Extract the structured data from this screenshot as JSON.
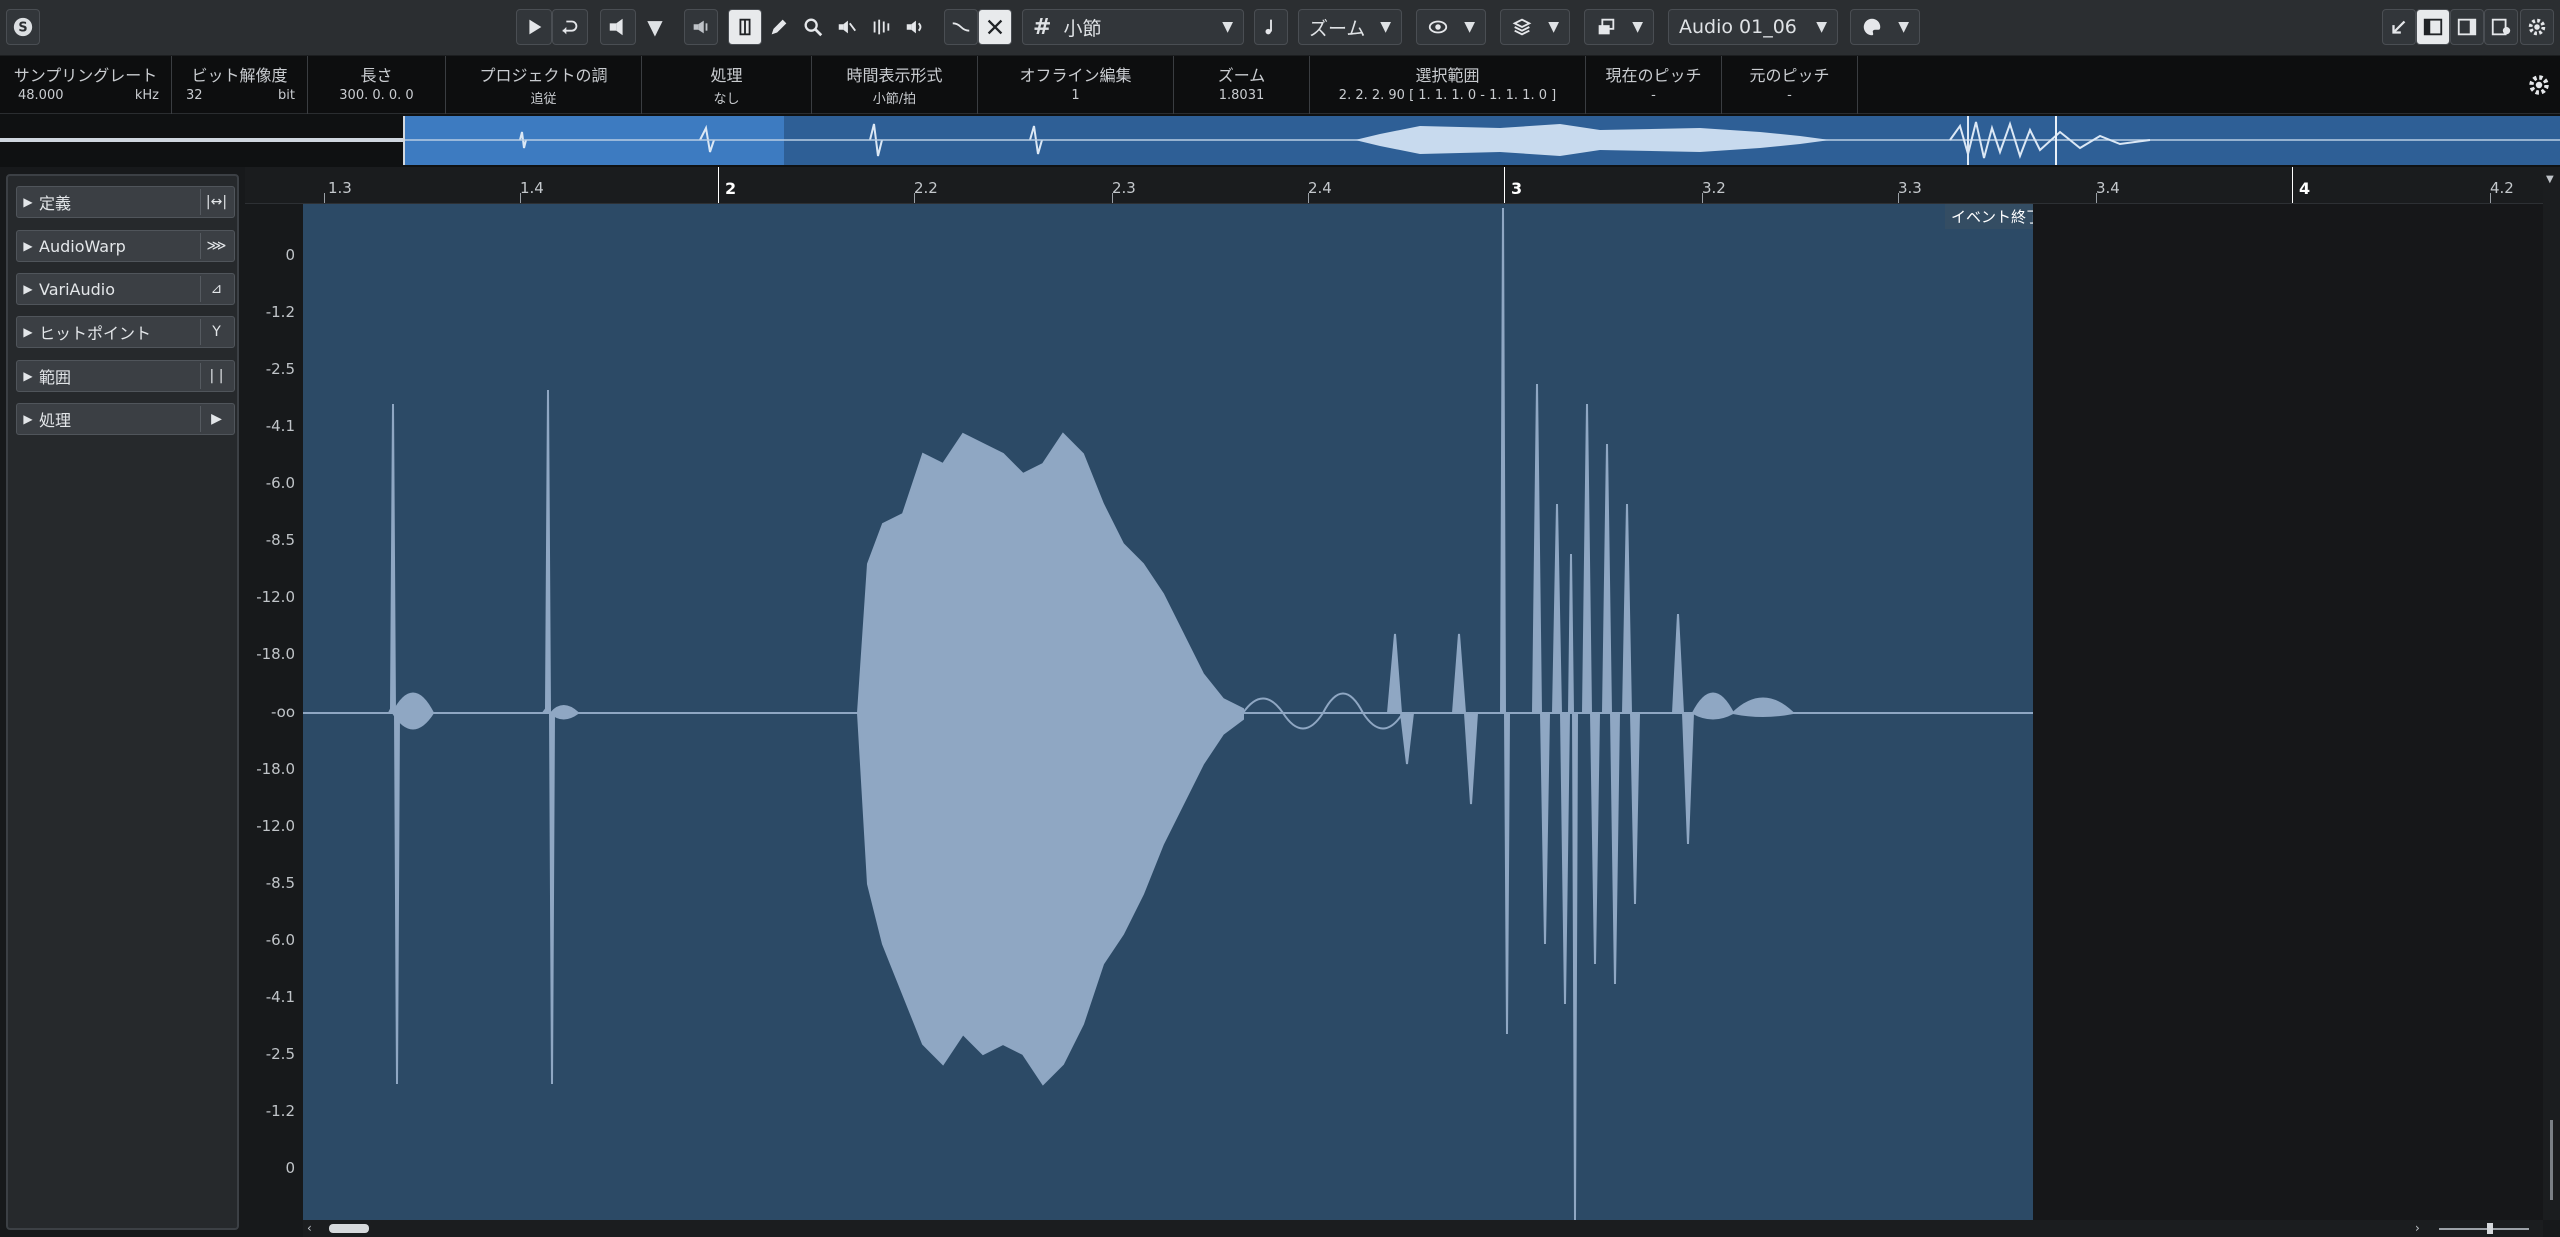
{
  "toolbar": {
    "snap_grid_label": "小節",
    "zoom_label": "ズーム",
    "event_name": "Audio 01_06"
  },
  "info_line": {
    "columns": [
      {
        "header": "サンプリングレート",
        "value": "48.000",
        "unit": "kHz"
      },
      {
        "header": "ビット解像度",
        "value": "32",
        "unit": "bit"
      },
      {
        "header": "長さ",
        "value": "300. 0. 0.  0",
        "unit": ""
      },
      {
        "header": "プロジェクトの調",
        "value": "追従",
        "unit": ""
      },
      {
        "header": "処理",
        "value": "なし",
        "unit": ""
      },
      {
        "header": "時間表示形式",
        "value": "小節/拍",
        "unit": ""
      },
      {
        "header": "オフライン編集",
        "value": "1",
        "unit": ""
      },
      {
        "header": "ズーム",
        "value": "1.8031",
        "unit": ""
      },
      {
        "header": "選択範囲",
        "value": "2. 2. 2. 90 [ 1. 1. 1.  0 - 1. 1. 1.  0 ]",
        "unit": ""
      },
      {
        "header": "現在のピッチ",
        "value": "-",
        "unit": ""
      },
      {
        "header": "元のピッチ",
        "value": "-",
        "unit": ""
      }
    ]
  },
  "ruler": {
    "labels": [
      "1.3",
      "1.4",
      "2",
      "2.2",
      "2.3",
      "2.4",
      "3",
      "3.2",
      "3.3",
      "3.4",
      "4",
      "4.2"
    ],
    "major": [
      "2",
      "3",
      "4"
    ]
  },
  "scale": {
    "unit": "db",
    "top": [
      "0",
      "-1.2",
      "-2.5",
      "-4.1",
      "-6.0",
      "-8.5",
      "-12.0",
      "-18.0"
    ],
    "center": "-oo",
    "bottom": [
      "-18.0",
      "-12.0",
      "-8.5",
      "-6.0",
      "-4.1",
      "-2.5",
      "-1.2",
      "0"
    ]
  },
  "inspector": {
    "sections": [
      {
        "label": "定義",
        "icon": "define-icon"
      },
      {
        "label": "AudioWarp",
        "icon": "audiowarp-icon"
      },
      {
        "label": "VariAudio",
        "icon": "variaudio-icon"
      },
      {
        "label": "ヒットポイント",
        "icon": "hitpoint-icon"
      },
      {
        "label": "範囲",
        "icon": "range-icon"
      },
      {
        "label": "処理",
        "icon": "process-icon"
      }
    ]
  },
  "waveform": {
    "event_end_label": "イベント終了"
  },
  "colors": {
    "waveform_bg": "#2c4a66",
    "waveform_fill": "#8fa7c3",
    "overview_selected": "#3d7bc1",
    "overview_unselected": "#2e5f96"
  }
}
